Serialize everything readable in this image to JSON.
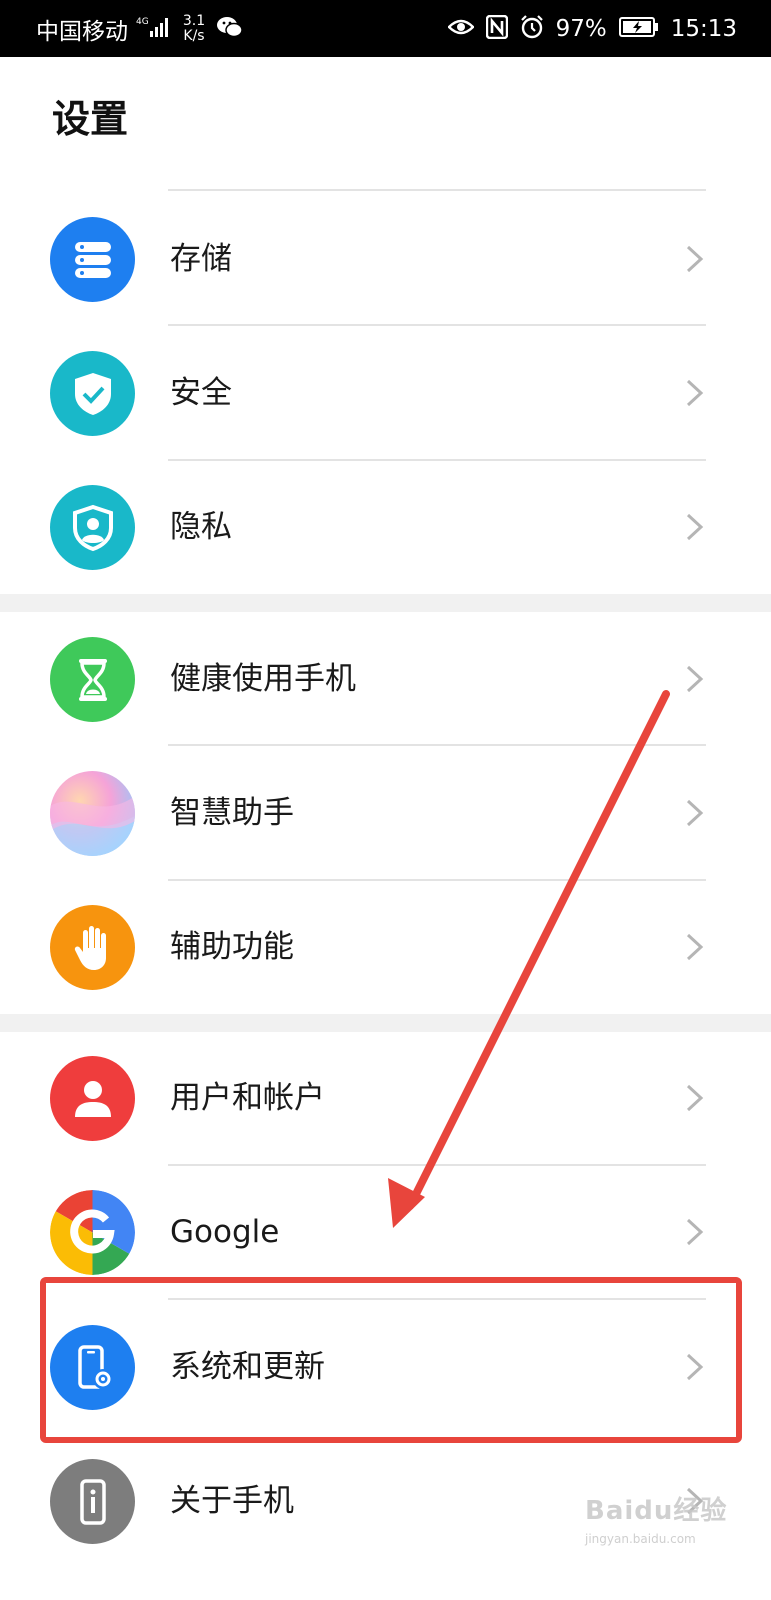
{
  "status_bar": {
    "carrier": "中国移动",
    "network": "4G",
    "speed_value": "3.1",
    "speed_unit": "K/s",
    "battery": "97%",
    "time": "15:13"
  },
  "title": "设置",
  "items": [
    {
      "label": "存储",
      "icon": "storage-icon",
      "color": "#1e7ff0"
    },
    {
      "label": "安全",
      "icon": "security-shield-icon",
      "color": "#19b8c9"
    },
    {
      "label": "隐私",
      "icon": "privacy-icon",
      "color": "#19b8c9"
    },
    {
      "label": "健康使用手机",
      "icon": "hourglass-icon",
      "color": "#3fc95a"
    },
    {
      "label": "智慧助手",
      "icon": "assistant-icon",
      "color": "#e9a5d6"
    },
    {
      "label": "辅助功能",
      "icon": "hand-icon",
      "color": "#f7940e"
    },
    {
      "label": "用户和帐户",
      "icon": "user-icon",
      "color": "#ef3d3d"
    },
    {
      "label": "Google",
      "icon": "google-icon",
      "color": "#4285f4"
    },
    {
      "label": "系统和更新",
      "icon": "system-update-icon",
      "color": "#1e7ff0"
    },
    {
      "label": "关于手机",
      "icon": "about-phone-icon",
      "color": "#7d7d7d"
    }
  ],
  "annotation": {
    "highlighted_item": "系统和更新",
    "color": "#e8453c"
  },
  "watermark": {
    "text": "Baidu经验",
    "sub": "jingyan.baidu.com"
  }
}
